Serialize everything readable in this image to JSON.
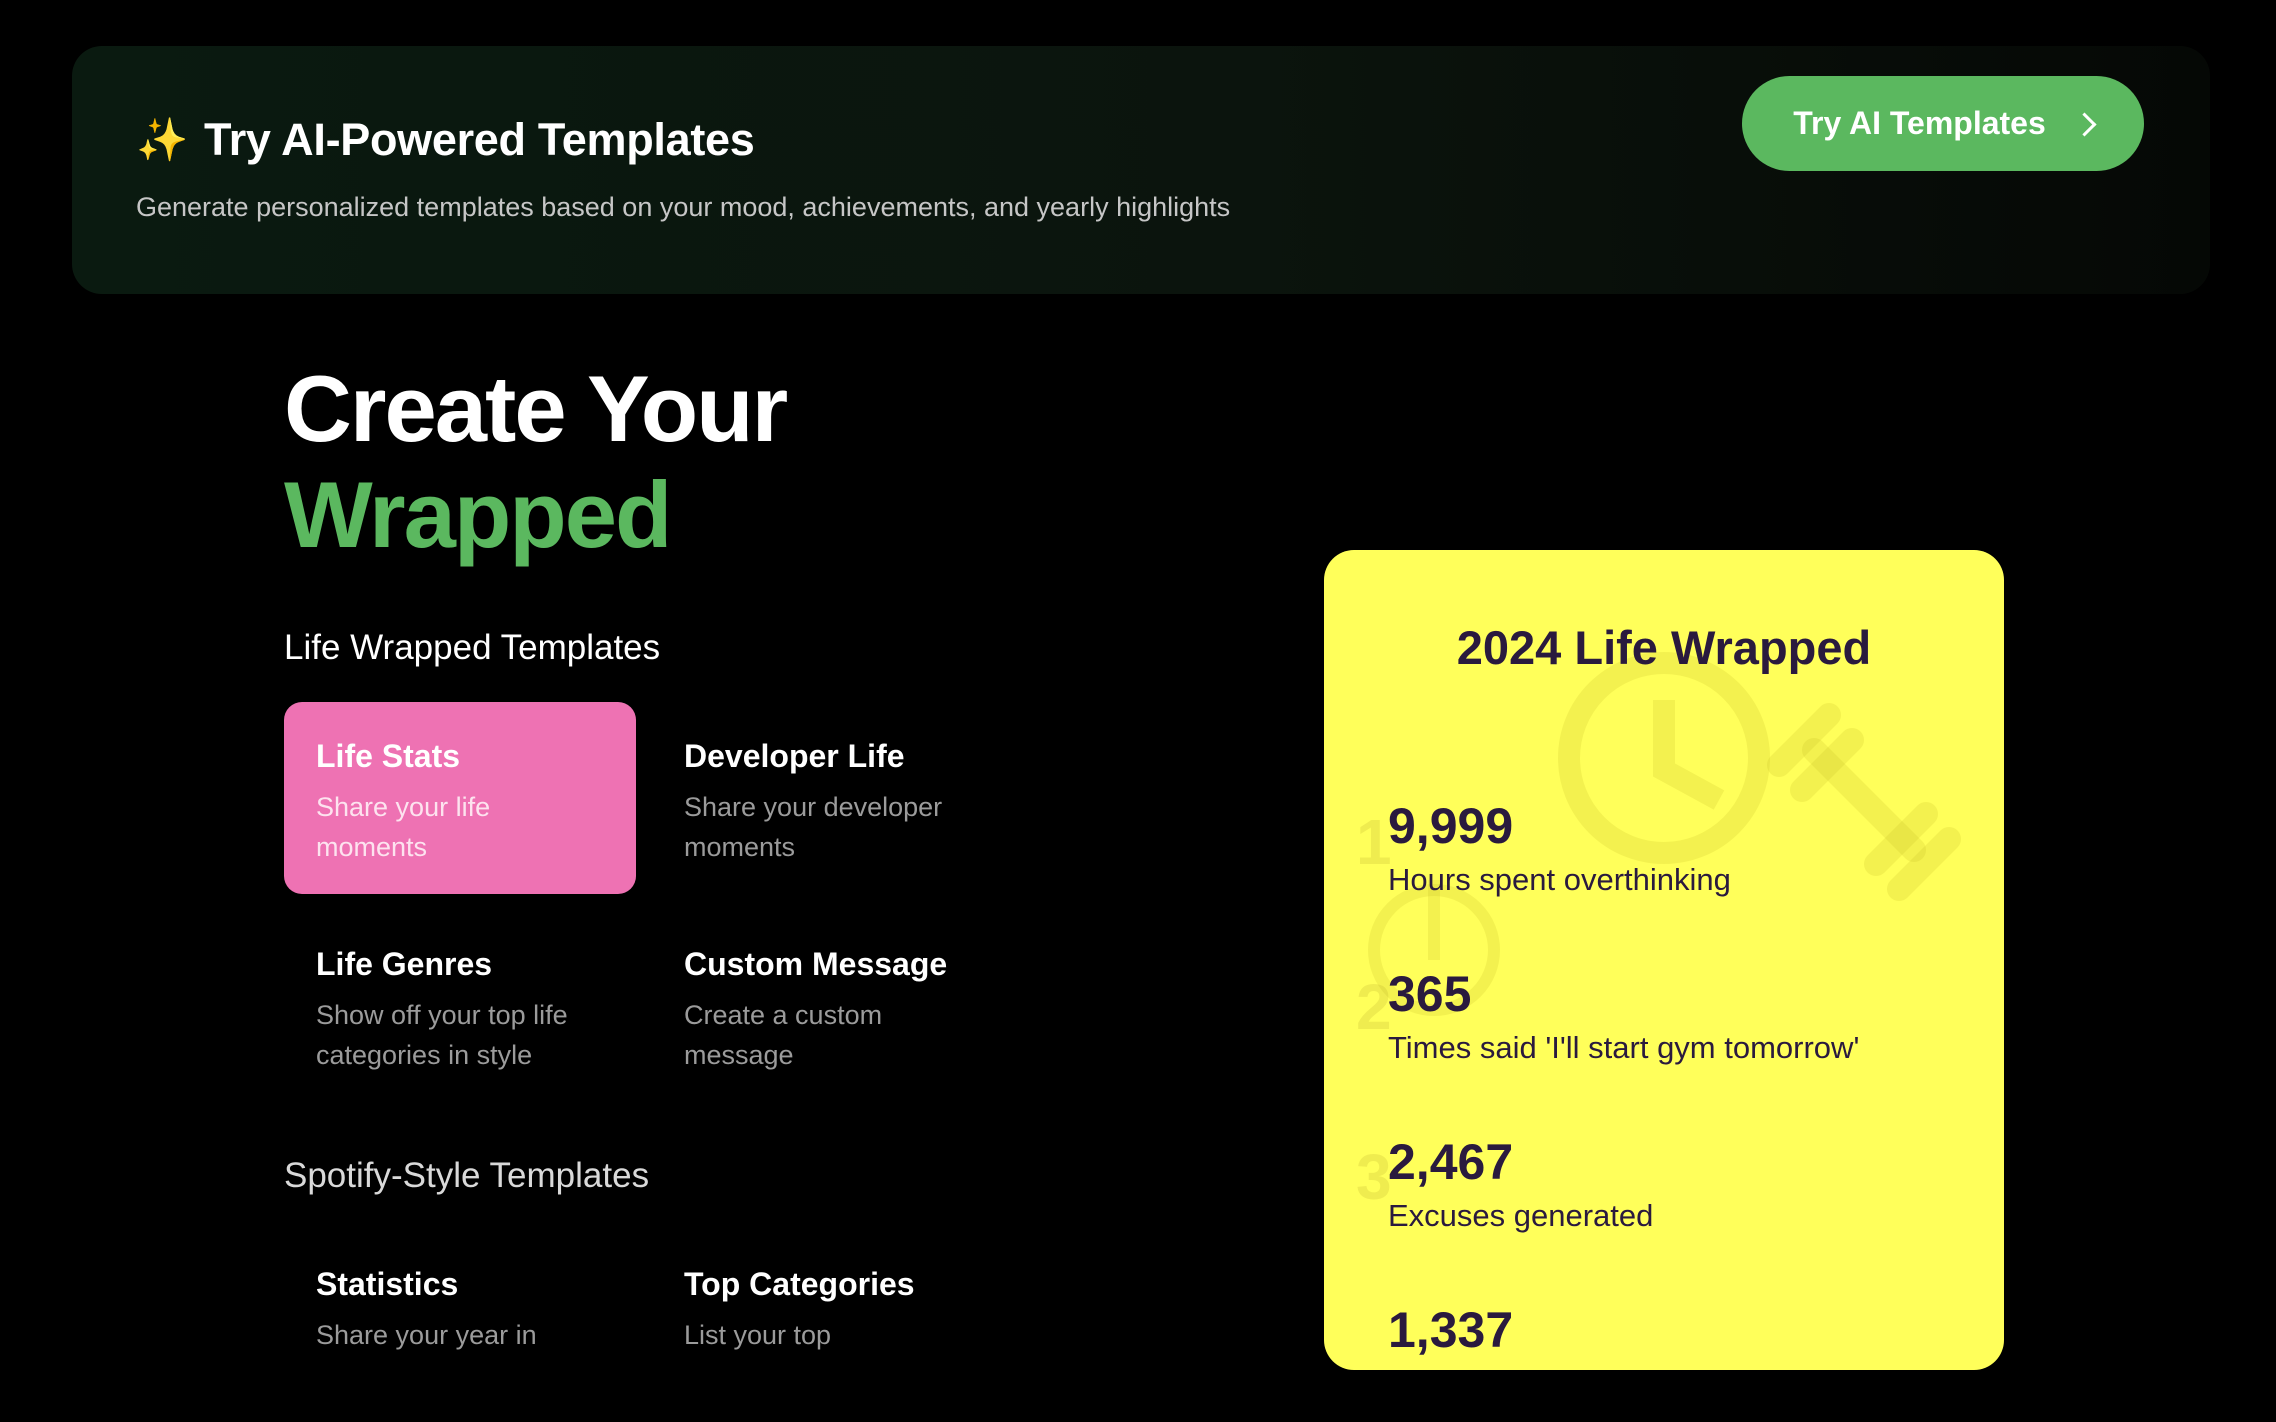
{
  "banner": {
    "sparkle": "✨",
    "title": "Try AI-Powered Templates",
    "subtitle": "Generate personalized templates based on your mood, achievements, and yearly highlights",
    "button_label": "Try AI Templates"
  },
  "hero": {
    "line1": "Create Your",
    "line2": "Wrapped"
  },
  "life_section": {
    "title": "Life Wrapped Templates",
    "cards": [
      {
        "title": "Life Stats",
        "desc": "Share your life moments"
      },
      {
        "title": "Developer Life",
        "desc": "Share your developer moments"
      },
      {
        "title": "Life Genres",
        "desc": "Show off your top life categories in style"
      },
      {
        "title": "Custom Message",
        "desc": "Create a custom message"
      }
    ]
  },
  "spotify_section": {
    "title": "Spotify-Style Templates",
    "cards": [
      {
        "title": "Statistics",
        "desc": "Share your year in"
      },
      {
        "title": "Top Categories",
        "desc": "List your top"
      }
    ]
  },
  "preview": {
    "title": "2024 Life Wrapped",
    "ranks": [
      "1",
      "2",
      "3"
    ],
    "stats": [
      {
        "value": "9,999",
        "label": "Hours spent overthinking"
      },
      {
        "value": "365",
        "label": "Times said 'I'll start gym tomorrow'"
      },
      {
        "value": "2,467",
        "label": "Excuses generated"
      },
      {
        "value": "1,337",
        "label": ""
      }
    ]
  },
  "colors": {
    "accent_green": "#5bb85f",
    "active_card_pink": "#ee72b3",
    "preview_yellow": "#ffff5a",
    "preview_text": "#2a1a3e"
  }
}
